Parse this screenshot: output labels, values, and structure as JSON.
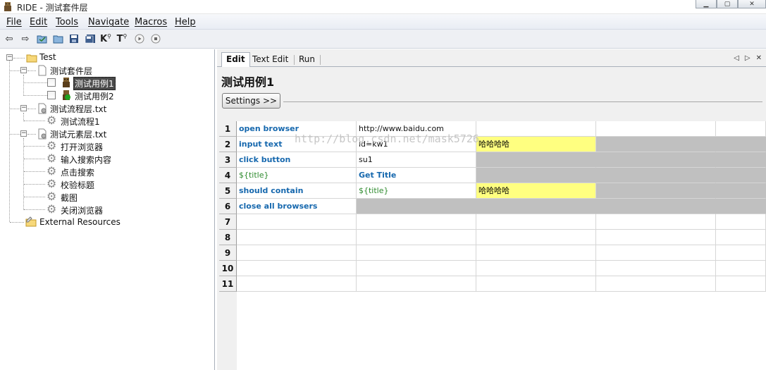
{
  "window": {
    "title": "RIDE - 测试套件层"
  },
  "menu": [
    "File",
    "Edit",
    "Tools",
    "Navigate",
    "Macros",
    "Help"
  ],
  "toolbar": {
    "icons": [
      "arrow-back-icon",
      "arrow-forward-icon",
      "open-test-suite-icon",
      "open-directory-icon",
      "save-icon",
      "save-all-icon",
      "search-keywords-icon",
      "search-tests-icon",
      "run-icon",
      "stop-icon"
    ],
    "keyword_glyph": "K",
    "test_glyph": "T"
  },
  "tree": {
    "root": "Test",
    "suite": "测试套件层",
    "tests": [
      "测试用例1",
      "测试用例2"
    ],
    "flow_file": "测试流程层.txt",
    "flow_keywords": [
      "测试流程1"
    ],
    "element_file": "测试元素层.txt",
    "element_keywords": [
      "打开浏览器",
      "输入搜索内容",
      "点击搜索",
      "校验标题",
      "截图",
      "关闭浏览器"
    ],
    "external": "External Resources"
  },
  "tabs": [
    "Edit",
    "Text Edit",
    "Run"
  ],
  "editor": {
    "title": "测试用例1",
    "settings_label": "Settings >>",
    "watermark": "http://blog.csdn.net/mask5726",
    "rows": [
      {
        "num": "1",
        "cells": [
          {
            "text": "open browser",
            "style": "kw"
          },
          {
            "text": "http://www.baidu.com",
            "style": "plain"
          },
          {
            "text": "",
            "style": ""
          },
          {
            "text": "",
            "style": ""
          },
          {
            "text": "",
            "style": ""
          }
        ]
      },
      {
        "num": "2",
        "cells": [
          {
            "text": "input text",
            "style": "kw"
          },
          {
            "text": "id=kw1",
            "style": "plain"
          },
          {
            "text": "哈哈哈哈",
            "style": "yellow"
          },
          {
            "text": "",
            "style": "gray"
          },
          {
            "text": "",
            "style": "gray"
          }
        ]
      },
      {
        "num": "3",
        "cells": [
          {
            "text": "click button",
            "style": "kw"
          },
          {
            "text": "su1",
            "style": "plain"
          },
          {
            "text": "",
            "style": "gray"
          },
          {
            "text": "",
            "style": "gray"
          },
          {
            "text": "",
            "style": "gray"
          }
        ]
      },
      {
        "num": "4",
        "cells": [
          {
            "text": "${title}",
            "style": "var"
          },
          {
            "text": "Get Title",
            "style": "kw"
          },
          {
            "text": "",
            "style": "gray"
          },
          {
            "text": "",
            "style": "gray"
          },
          {
            "text": "",
            "style": "gray"
          }
        ]
      },
      {
        "num": "5",
        "cells": [
          {
            "text": "should contain",
            "style": "kw"
          },
          {
            "text": "${title}",
            "style": "var"
          },
          {
            "text": "哈哈哈哈",
            "style": "yellow"
          },
          {
            "text": "",
            "style": "gray"
          },
          {
            "text": "",
            "style": "gray"
          }
        ]
      },
      {
        "num": "6",
        "cells": [
          {
            "text": "close all browsers",
            "style": "kw"
          },
          {
            "text": "",
            "style": "gray"
          },
          {
            "text": "",
            "style": "gray"
          },
          {
            "text": "",
            "style": "gray"
          },
          {
            "text": "",
            "style": "gray"
          }
        ]
      },
      {
        "num": "7",
        "cells": [
          {
            "text": "",
            "style": ""
          },
          {
            "text": "",
            "style": ""
          },
          {
            "text": "",
            "style": ""
          },
          {
            "text": "",
            "style": ""
          },
          {
            "text": "",
            "style": ""
          }
        ]
      },
      {
        "num": "8",
        "cells": [
          {
            "text": "",
            "style": ""
          },
          {
            "text": "",
            "style": ""
          },
          {
            "text": "",
            "style": ""
          },
          {
            "text": "",
            "style": ""
          },
          {
            "text": "",
            "style": ""
          }
        ]
      },
      {
        "num": "9",
        "cells": [
          {
            "text": "",
            "style": ""
          },
          {
            "text": "",
            "style": ""
          },
          {
            "text": "",
            "style": ""
          },
          {
            "text": "",
            "style": ""
          },
          {
            "text": "",
            "style": ""
          }
        ]
      },
      {
        "num": "10",
        "cells": [
          {
            "text": "",
            "style": ""
          },
          {
            "text": "",
            "style": ""
          },
          {
            "text": "",
            "style": ""
          },
          {
            "text": "",
            "style": ""
          },
          {
            "text": "",
            "style": ""
          }
        ]
      },
      {
        "num": "11",
        "cells": [
          {
            "text": "",
            "style": ""
          },
          {
            "text": "",
            "style": ""
          },
          {
            "text": "",
            "style": ""
          },
          {
            "text": "",
            "style": ""
          },
          {
            "text": "",
            "style": ""
          }
        ]
      }
    ]
  },
  "colors": {
    "keyword": "#1668ae",
    "variable": "#2e8b2e",
    "highlight": "#ffff80",
    "disabled": "#c0c0c0"
  }
}
